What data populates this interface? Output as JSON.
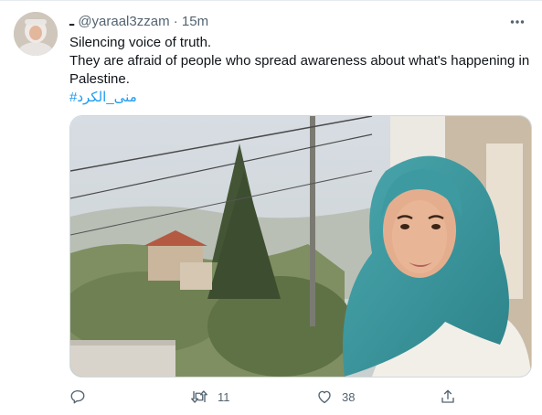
{
  "tweet": {
    "display_name": "ـ",
    "handle": "@yaraal3zzam",
    "separator": "·",
    "time": "15m",
    "lines": [
      "Silencing voice of truth.",
      "They are afraid of people who spread awareness about what's happening in Palestine."
    ],
    "hashtag": "#منى_الكرد"
  },
  "actions": {
    "reply_count": "",
    "retweet_count": "11",
    "like_count": "38"
  },
  "icons": {
    "more": "more-icon",
    "reply": "reply-icon",
    "retweet": "retweet-icon",
    "like": "heart-icon",
    "share": "share-icon"
  },
  "colors": {
    "text": "#0f1419",
    "secondary": "#536471",
    "link": "#1d9bf0",
    "border": "#cfd9de"
  }
}
